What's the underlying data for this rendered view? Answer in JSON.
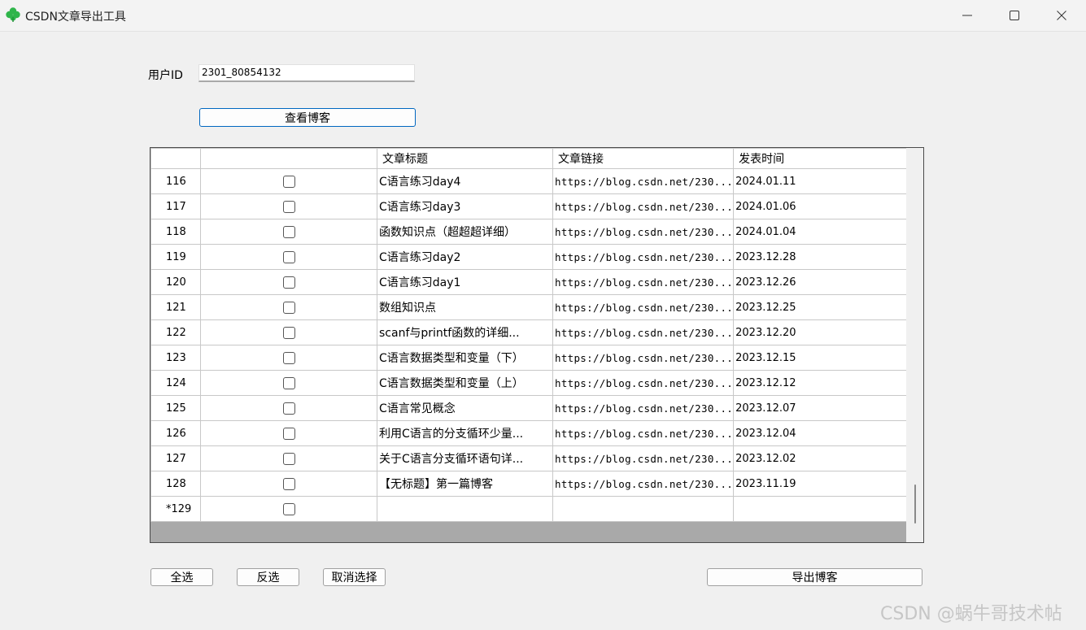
{
  "window": {
    "title": "CSDN文章导出工具",
    "icon": "clover-icon"
  },
  "form": {
    "user_label": "用户ID",
    "user_value": "2301_80854132",
    "view_button": "查看博客"
  },
  "grid": {
    "columns": [
      "",
      "",
      "文章标题",
      "文章链接",
      "发表时间"
    ],
    "rows": [
      {
        "num": "116",
        "title": "C语言练习day4",
        "link": "https://blog.csdn.net/230...",
        "date": "2024.01.11"
      },
      {
        "num": "117",
        "title": "C语言练习day3",
        "link": "https://blog.csdn.net/230...",
        "date": "2024.01.06"
      },
      {
        "num": "118",
        "title": "函数知识点（超超超详细）",
        "link": "https://blog.csdn.net/230...",
        "date": "2024.01.04"
      },
      {
        "num": "119",
        "title": "C语言练习day2",
        "link": "https://blog.csdn.net/230...",
        "date": "2023.12.28"
      },
      {
        "num": "120",
        "title": "C语言练习day1",
        "link": "https://blog.csdn.net/230...",
        "date": "2023.12.26"
      },
      {
        "num": "121",
        "title": "数组知识点",
        "link": "https://blog.csdn.net/230...",
        "date": "2023.12.25"
      },
      {
        "num": "122",
        "title": "scanf与printf函数的详细...",
        "link": "https://blog.csdn.net/230...",
        "date": "2023.12.20"
      },
      {
        "num": "123",
        "title": "C语言数据类型和变量（下）",
        "link": "https://blog.csdn.net/230...",
        "date": "2023.12.15"
      },
      {
        "num": "124",
        "title": "C语言数据类型和变量（上）",
        "link": "https://blog.csdn.net/230...",
        "date": "2023.12.12"
      },
      {
        "num": "125",
        "title": "C语言常见概念",
        "link": "https://blog.csdn.net/230...",
        "date": "2023.12.07"
      },
      {
        "num": "126",
        "title": "利用C语言的分支循环少量...",
        "link": "https://blog.csdn.net/230...",
        "date": "2023.12.04"
      },
      {
        "num": "127",
        "title": "关于C语言分支循环语句详...",
        "link": "https://blog.csdn.net/230...",
        "date": "2023.12.02"
      },
      {
        "num": "128",
        "title": "【无标题】第一篇博客",
        "link": "https://blog.csdn.net/230...",
        "date": "2023.11.19"
      },
      {
        "num": "*129",
        "title": "",
        "link": "",
        "date": ""
      }
    ]
  },
  "actions": {
    "select_all": "全选",
    "invert": "反选",
    "clear": "取消选择",
    "export": "导出博客"
  },
  "watermark": "CSDN @蜗牛哥技术帖",
  "colors": {
    "window_bg": "#f0f0f0",
    "accent_border": "#0067c0",
    "grid_empty": "#a9a9a9"
  }
}
